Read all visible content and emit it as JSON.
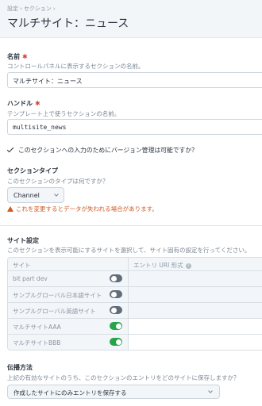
{
  "breadcrumb": [
    "設定",
    "セクション"
  ],
  "page_title": "マルチサイト：ニュース",
  "name_field": {
    "label": "名前",
    "help": "コントロールパネルに表示するセクションの名前。",
    "value": "マルチサイト：ニュース"
  },
  "handle_field": {
    "label": "ハンドル",
    "help": "テンプレート上で使うセクションの名前。",
    "value": "multisite_news"
  },
  "versioning": {
    "checked": true,
    "label": "このセクションへの入力のためにバージョン管理は可能ですか？"
  },
  "section_type": {
    "label": "セクションタイプ",
    "help": "このセクションのタイプは何ですか？",
    "selected": "Channel",
    "warning": "これを変更するとデータが失われる場合があります。"
  },
  "site_settings": {
    "label": "サイト設定",
    "help": "このセクションを表示可能にするサイトを選択して、サイト固有の設定を行ってください。",
    "columns": [
      "サイト",
      "エントリ URI 形式"
    ],
    "info_icon": "i",
    "rows": [
      {
        "name": "bit part dev",
        "enabled": false
      },
      {
        "name": "サンプルグローバル日本語サイト",
        "enabled": false
      },
      {
        "name": "サンプルグローバル英語サイト",
        "enabled": false
      },
      {
        "name": "マルチサイトAAA",
        "enabled": true
      },
      {
        "name": "マルチサイトBBB",
        "enabled": true
      }
    ]
  },
  "propagation": {
    "label": "伝播方法",
    "help": "上記の有効なサイトのうち、このセクションのエントリをどのサイトに保存しますか？",
    "selected": "作成したサイトにのみエントリを保存する"
  },
  "colors": {
    "toggle_on": "#26a34b",
    "toggle_off": "#606d7b",
    "warning": "#cf5a23",
    "required": "#d0463c"
  }
}
